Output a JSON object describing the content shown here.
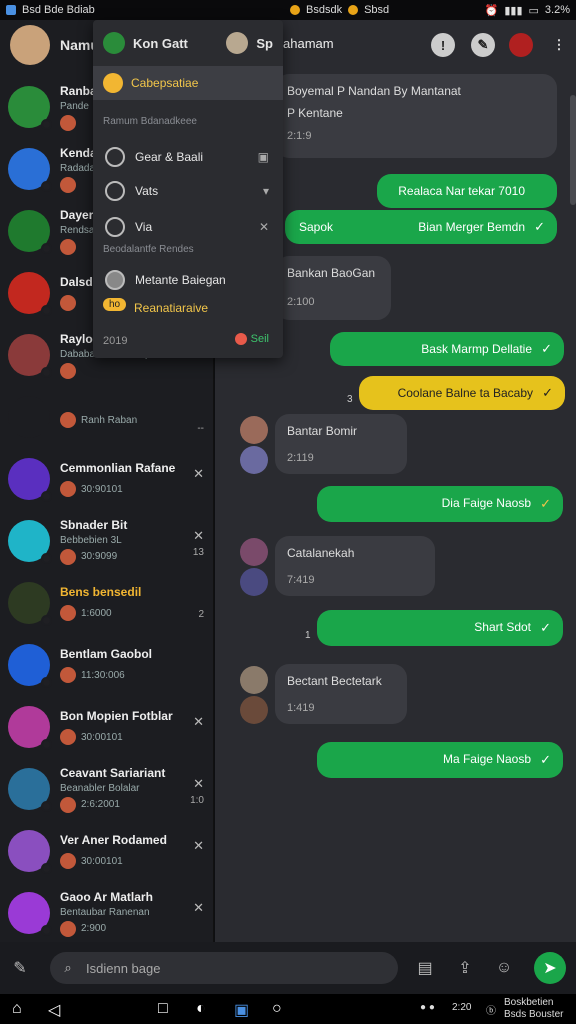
{
  "status_bar": {
    "left_text": "Bsd Bde Bdiab",
    "center_text": "Bsdsdk",
    "center_text2": "Sbsd",
    "right_text": "3.2%"
  },
  "left_pane": {
    "profile_name": "Namun",
    "chats": [
      {
        "title": "Ranbas",
        "subtitle": "Pande",
        "meta": "",
        "x": false,
        "count": "",
        "color": "#2a8c3a"
      },
      {
        "title": "Kendan",
        "subtitle": "Radadanb",
        "meta": "",
        "x": false,
        "count": "",
        "color": "#2a6fd6"
      },
      {
        "title": "Dayers",
        "subtitle": "Rendsan",
        "meta": "",
        "x": false,
        "count": "",
        "color": "#1f7a2e"
      },
      {
        "title": "Dalsdar",
        "subtitle": "",
        "meta": "",
        "x": false,
        "count": "",
        "color": "#c2281f"
      },
      {
        "title": "Raylon",
        "subtitle": "Dababar Bdbdk Dopie",
        "meta": "",
        "x": false,
        "count": "",
        "color": "#8a3a3a"
      },
      {
        "title": "",
        "subtitle": "",
        "meta": "Ranh Raban",
        "x": false,
        "count": "--",
        "color": "#1c1d21"
      },
      {
        "title": "Cemmonlian Rafane",
        "subtitle": "",
        "meta": "30:90101",
        "x": true,
        "count": "",
        "color": "#5a2fbf"
      },
      {
        "title": "Sbnader Bit",
        "subtitle": "Bebbebien 3L",
        "meta": "30:9099",
        "x": true,
        "count": "13",
        "color": "#1fb4c8"
      },
      {
        "title": "Bens bensedil",
        "subtitle": "",
        "meta": "1:6000",
        "x": false,
        "count": "2",
        "color": "#2d3a22",
        "yellow": true
      },
      {
        "title": "Bentlam Gaobol",
        "subtitle": "",
        "meta": "11:30:006",
        "x": false,
        "count": "",
        "color": "#1f5fd6"
      },
      {
        "title": "Bon Mopien Fotblar",
        "subtitle": "",
        "meta": "30:00101",
        "x": true,
        "count": "",
        "color": "#b03a9a"
      },
      {
        "title": "Ceavant Sariariant",
        "subtitle": "Beanabler Bolalar",
        "meta": "2:6:2001",
        "x": true,
        "count": "1:0",
        "color": "#2a6f9a"
      },
      {
        "title": "Ver Aner Rodamed",
        "subtitle": "",
        "meta": "30:00101",
        "x": true,
        "count": "",
        "color": "#8a4fbf"
      },
      {
        "title": "Gaoo Ar Matlarh",
        "subtitle": "Bentaubar Ranenan",
        "meta": "2:900",
        "x": true,
        "count": "",
        "color": "#9a3ad6"
      }
    ]
  },
  "chat_header": {
    "title": "ahamam"
  },
  "messages": [
    {
      "type": "in",
      "text": "Boyemal P Nandan By Mantanat",
      "text2": "P Kentane",
      "time": "2:1:9"
    },
    {
      "type": "out",
      "text": "Realaca Nar tekar 7010"
    },
    {
      "type": "out",
      "text": "Bian Merger Bemdn",
      "lead": "Sapok"
    },
    {
      "type": "in",
      "text": "Bankan BaoGan",
      "time": "2:100"
    },
    {
      "type": "out",
      "text": "Bask Marmp Dellatie"
    },
    {
      "type": "out_yellow",
      "text": "Coolane Balne ta Bacaby",
      "lead": "3"
    },
    {
      "type": "in",
      "text": "Bantar Bomir",
      "time": "2:119"
    },
    {
      "type": "out",
      "text": "Dia Faige Naosb"
    },
    {
      "type": "in",
      "text": "Catalanekah",
      "time": "7:419"
    },
    {
      "type": "out",
      "text": "Shart Sdot",
      "lead": "1"
    },
    {
      "type": "in",
      "text": "Bectant Bectetark",
      "time": "1:419"
    },
    {
      "type": "out",
      "text": "Ma Faige Naosb"
    }
  ],
  "menu": {
    "header_name": "Kon Gatt",
    "header_right": "Sp",
    "selected_label": "Cabepsatiae",
    "section1": "Ramum Bdanadkeee",
    "item1": "Gear & Baali",
    "item2": "Vats",
    "item3": "Via",
    "section2": "Beodalantfe Rendes",
    "item4": "Metante Baiegan",
    "badge": "ho",
    "badge_label": "Reanatiaraive",
    "footer_left": "2019",
    "footer_right": "Seil"
  },
  "composer": {
    "placeholder": "Isdienn bage"
  },
  "nav_bar": {
    "right_text1": "2:20",
    "right_text2": "Boskbetien",
    "right_text3": "Bsds Bouster"
  }
}
